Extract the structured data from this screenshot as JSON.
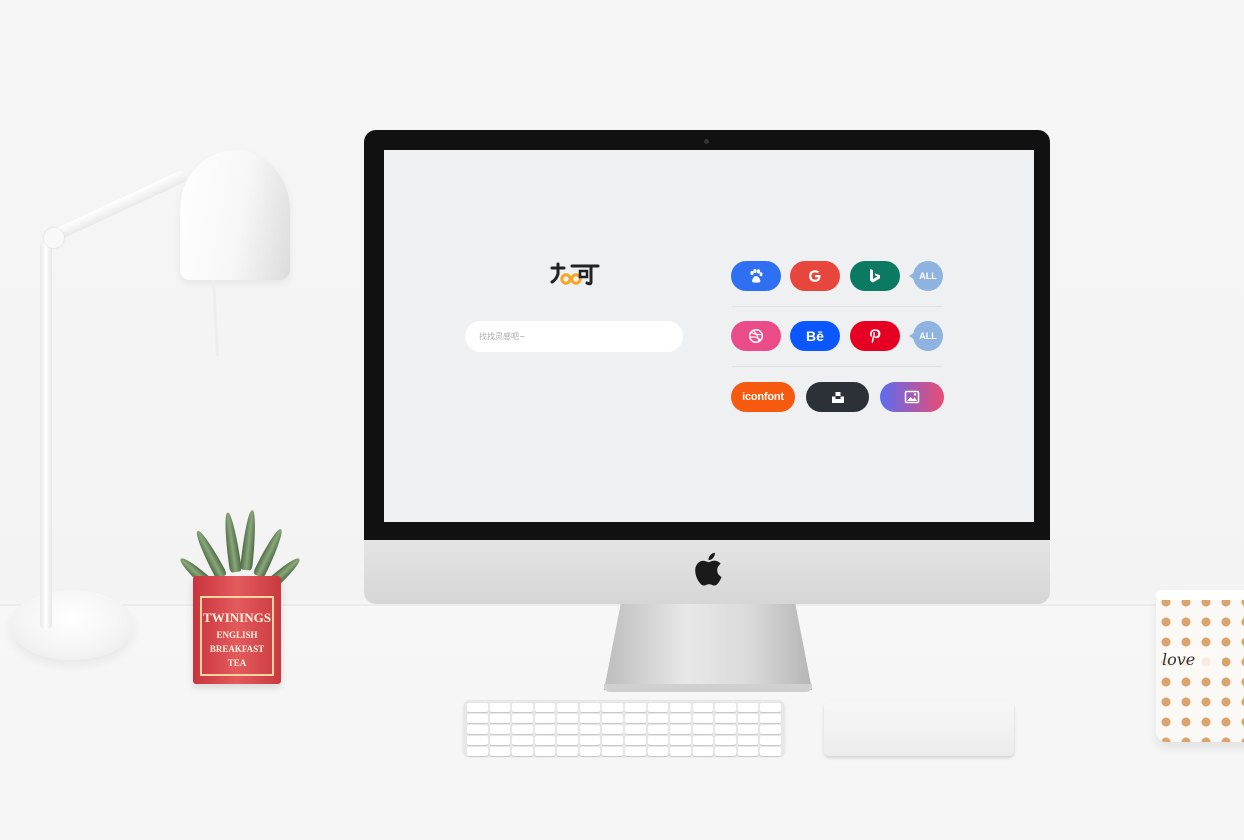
{
  "scene": {
    "plant_tin": {
      "brand": "TWININGS",
      "line1": "ENGLISH",
      "line2": "BREAKFAST",
      "line3": "TEA"
    },
    "mug_text": "love"
  },
  "screen": {
    "search": {
      "placeholder": "找找灵感吧~"
    },
    "rows": [
      {
        "name": "search-engines",
        "items": [
          {
            "icon": "baidu-paw-icon",
            "color": "#2f6ff1"
          },
          {
            "icon": "google-g-icon",
            "color": "#e8453c"
          },
          {
            "icon": "bing-b-icon",
            "color": "#0c7a63"
          }
        ],
        "all_label": "ALL"
      },
      {
        "name": "design-sites",
        "items": [
          {
            "icon": "dribbble-ball-icon",
            "color": "#ea4c89"
          },
          {
            "icon": "behance-icon",
            "label": "Bē",
            "color": "#0b57ff"
          },
          {
            "icon": "pinterest-p-icon",
            "color": "#e60023"
          }
        ],
        "all_label": "ALL"
      },
      {
        "name": "resource-sites",
        "items": [
          {
            "icon": "iconfont-logo",
            "label": "iconfont",
            "color": "#f55a0e"
          },
          {
            "icon": "unsplash-icon",
            "color": "#2c3138"
          },
          {
            "icon": "image-gallery-icon",
            "color": "#7a5cf0"
          }
        ]
      }
    ]
  }
}
